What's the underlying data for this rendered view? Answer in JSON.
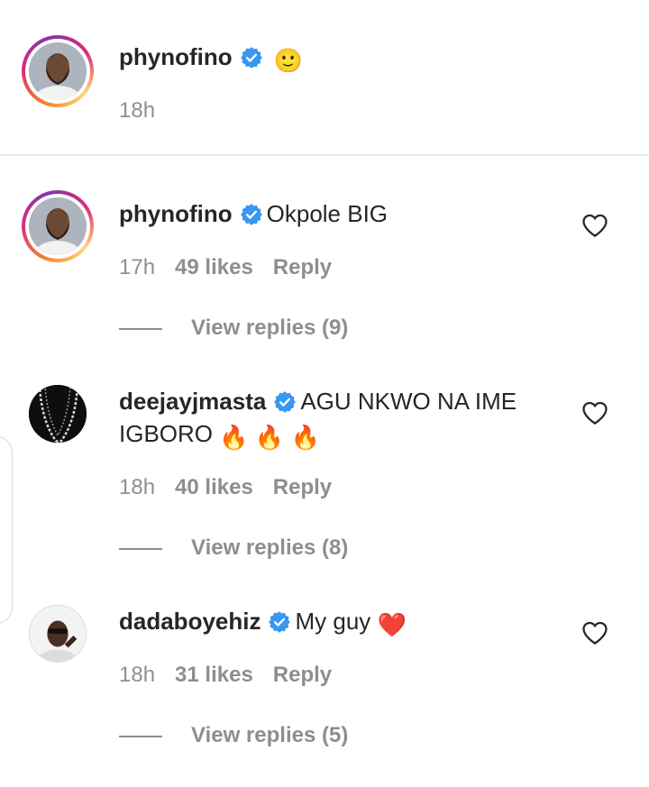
{
  "caption": {
    "username": "phynofino",
    "emoji": "🙂",
    "time": "18h"
  },
  "comments": [
    {
      "username": "phynofino",
      "text": "Okpole BIG",
      "time": "17h",
      "likes": "49 likes",
      "reply": "Reply",
      "view_replies": "View replies (9)"
    },
    {
      "username": "deejayjmasta",
      "text": "AGU NKWO NA IME IGBORO",
      "emoji": "🔥 🔥 🔥",
      "time": "18h",
      "likes": "40 likes",
      "reply": "Reply",
      "view_replies": "View replies (8)"
    },
    {
      "username": "dadaboyehiz",
      "text": "My guy",
      "emoji": "❤️",
      "time": "18h",
      "likes": "31 likes",
      "reply": "Reply",
      "view_replies": "View replies (5)"
    }
  ],
  "icons": {
    "verified": "verified-badge-icon",
    "like": "heart-icon"
  },
  "colors": {
    "verified_blue": "#3897f0",
    "muted_text": "#8e8e8e",
    "text": "#262626",
    "story_ring_start": "#f58529",
    "story_ring_end": "#dd2a7b"
  }
}
